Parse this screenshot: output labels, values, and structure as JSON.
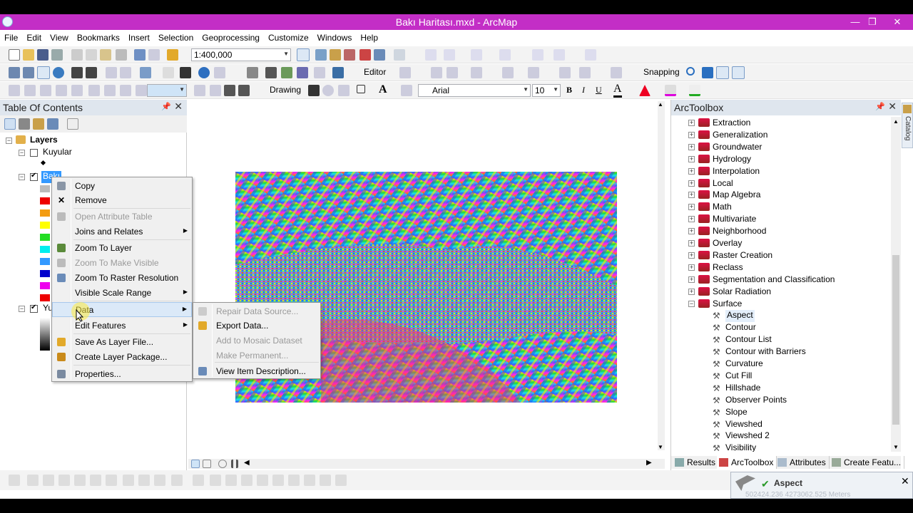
{
  "window": {
    "title": "Bakı Haritası.mxd - ArcMap",
    "min": "—",
    "restore": "❐",
    "close": "✕"
  },
  "menubar": [
    "File",
    "Edit",
    "View",
    "Bookmarks",
    "Insert",
    "Selection",
    "Geoprocessing",
    "Customize",
    "Windows",
    "Help"
  ],
  "toolbar": {
    "scale": "1:400,000",
    "editor": "Editor",
    "snapping": "Snapping",
    "drawing": "Drawing",
    "font": "Arial",
    "font_size": "10",
    "bold": "B",
    "italic": "I",
    "underline": "U",
    "text_a": "A"
  },
  "toc": {
    "title": "Table Of Contents",
    "layers_label": "Layers",
    "layer1": "Kuyular",
    "layer2_partial": "Bakı",
    "layer3_partial": "Yu"
  },
  "context_menu": {
    "items": [
      {
        "label": "Copy",
        "icon": "copy-icon"
      },
      {
        "label": "Remove",
        "icon": "remove-x-icon"
      },
      {
        "label": "Open Attribute Table",
        "icon": "table-icon"
      },
      {
        "label": "Joins and Relates",
        "icon": ""
      },
      {
        "label": "Zoom To Layer",
        "icon": "zoom-layer-icon"
      },
      {
        "label": "Zoom To Make Visible",
        "icon": "zoom-visible-icon"
      },
      {
        "label": "Zoom To Raster Resolution",
        "icon": "raster-resolution-icon"
      },
      {
        "label": "Visible Scale Range",
        "icon": ""
      },
      {
        "label": "Data",
        "icon": ""
      },
      {
        "label": "Edit Features",
        "icon": ""
      },
      {
        "label": "Save As Layer File...",
        "icon": "layer-file-icon"
      },
      {
        "label": "Create Layer Package...",
        "icon": "layer-package-icon"
      },
      {
        "label": "Properties...",
        "icon": "properties-icon"
      }
    ]
  },
  "data_submenu": {
    "items": [
      {
        "label": "Repair Data Source..."
      },
      {
        "label": "Export Data..."
      },
      {
        "label": "Add to Mosaic Dataset"
      },
      {
        "label": "Make Permanent..."
      },
      {
        "label": "View Item Description..."
      }
    ]
  },
  "toolbox": {
    "title": "ArcToolbox",
    "toolsets": [
      "Extraction",
      "Generalization",
      "Groundwater",
      "Hydrology",
      "Interpolation",
      "Local",
      "Map Algebra",
      "Math",
      "Multivariate",
      "Neighborhood",
      "Overlay",
      "Raster Creation",
      "Reclass",
      "Segmentation and Classification",
      "Solar Radiation",
      "Surface"
    ],
    "surface_tools": [
      "Aspect",
      "Contour",
      "Contour List",
      "Contour with Barriers",
      "Curvature",
      "Cut Fill",
      "Hillshade",
      "Observer Points",
      "Slope",
      "Viewshed",
      "Viewshed 2",
      "Visibility"
    ],
    "tabs": [
      "Results",
      "ArcToolbox",
      "Attributes",
      "Create Featu..."
    ],
    "catalog_tab": "Catalog"
  },
  "notification": {
    "title": "Aspect",
    "coords": "502424.236  4273062.525 Meters"
  },
  "colors": {
    "titlebar": "#c32ec6",
    "panel_header": "#dfe6ee",
    "menu_highlight": "#dbe9f8"
  }
}
